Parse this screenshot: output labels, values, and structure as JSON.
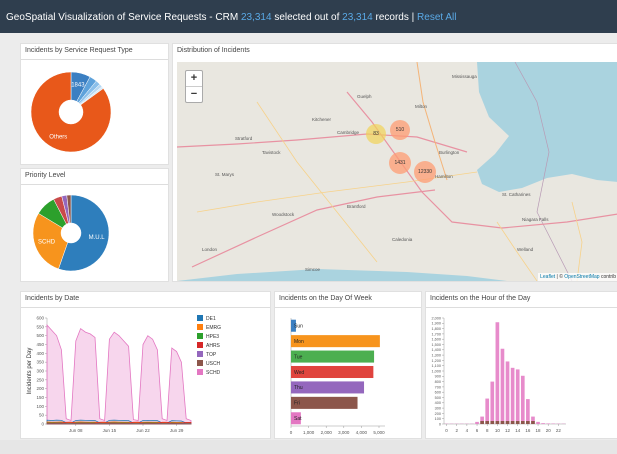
{
  "header": {
    "title": "GeoSpatial Visualization of Service Requests - CRM",
    "selected_count": "23,314",
    "selected_text": "selected out of",
    "total_count": "23,314",
    "records_text": "records |",
    "reset_label": "Reset All"
  },
  "panels": {
    "type_title": "Incidents by Service Request Type",
    "priority_title": "Priority Level",
    "map_title": "Distribution of Incidents",
    "date_title": "Incidents by Date",
    "week_title": "Incidents on the Day Of Week",
    "hour_title": "Incidents on the Hour of the Day"
  },
  "map": {
    "zoom_in": "+",
    "zoom_out": "−",
    "attribution_leaflet": "Leaflet",
    "attribution_sep": " | © ",
    "attribution_osm": "OpenStreetMap",
    "attribution_tail": " contrib",
    "clusters": [
      "83",
      "510",
      "1431",
      "12330"
    ],
    "labels": [
      "Guelph",
      "Kitchener",
      "Cambridge",
      "Stratford",
      "Tavistock",
      "St. Marys",
      "Brantford",
      "Woodstock",
      "London",
      "Burlington",
      "Hamilton",
      "Mississauga",
      "St. Catharines",
      "Niagara Falls",
      "Welland",
      "Caledonia",
      "Milton",
      "Simcoe"
    ]
  },
  "chart_data": [
    {
      "type": "pie",
      "title": "Incidents by Service Request Type",
      "labels": [
        "1843",
        "",
        "",
        "",
        "",
        "Others"
      ],
      "values": [
        1843,
        700,
        450,
        300,
        200,
        19821
      ],
      "colors": [
        "#3b7fc2",
        "#5ea2db",
        "#8cc0ea",
        "#b7d8f2",
        "#d6e9f8",
        "#e8581a"
      ]
    },
    {
      "type": "pie",
      "title": "Priority Level",
      "labels": [
        "M.U.L",
        "SCHD",
        "",
        "",
        "",
        ""
      ],
      "values": [
        12900,
        6600,
        2050,
        850,
        500,
        414
      ],
      "colors": [
        "#2e7ebc",
        "#f7941d",
        "#2ca02c",
        "#c94a4a",
        "#9467bd",
        "#8c564b"
      ]
    },
    {
      "type": "area",
      "title": "Incidents by Date",
      "ylabel": "Incidents per Day",
      "yticks": [
        "0",
        "50",
        "100",
        "150",
        "200",
        "250",
        "300",
        "350",
        "400",
        "450",
        "500",
        "550",
        "600"
      ],
      "xticks": [
        "Jun 08",
        "Jun 15",
        "Jun 22",
        "Jun 29"
      ],
      "ylim": [
        0,
        600
      ],
      "legend": [
        "DE1",
        "EMRG",
        "HPE3",
        "AHRS",
        "TOP",
        "USCH",
        "SCHD"
      ],
      "legend_colors": [
        "#1f77b4",
        "#ff7f0e",
        "#2ca02c",
        "#d62728",
        "#9467bd",
        "#8c564b",
        "#e377c2"
      ],
      "x_days": [
        0,
        1,
        2,
        3,
        4,
        5,
        6,
        7,
        8,
        9,
        10,
        11,
        12,
        13,
        14,
        15,
        16,
        17,
        18,
        19,
        20,
        21,
        22,
        23,
        24,
        25,
        26,
        27,
        28,
        29,
        30
      ],
      "tick_days": [
        6,
        13,
        20,
        27
      ],
      "series": [
        {
          "name": "SCHD",
          "values": [
            560,
            530,
            500,
            420,
            30,
            20,
            470,
            540,
            520,
            510,
            490,
            30,
            20,
            480,
            520,
            500,
            470,
            440,
            25,
            20,
            450,
            500,
            480,
            420,
            30,
            20,
            430,
            410,
            350,
            30,
            20
          ]
        },
        {
          "name": "DE1",
          "values": [
            22,
            20,
            22,
            21,
            8,
            6,
            20,
            22,
            21,
            20,
            20,
            7,
            6,
            21,
            22,
            21,
            20,
            19,
            6,
            6,
            20,
            21,
            20,
            19,
            6,
            5,
            19,
            18,
            17,
            6,
            5
          ]
        },
        {
          "name": "EMRG",
          "values": [
            12,
            10,
            11,
            12,
            8,
            7,
            11,
            12,
            11,
            10,
            11,
            8,
            7,
            11,
            12,
            11,
            10,
            10,
            7,
            7,
            10,
            11,
            10,
            10,
            7,
            6,
            10,
            9,
            9,
            6,
            6
          ]
        },
        {
          "name": "HPE3",
          "values": [
            8,
            7,
            8,
            8,
            4,
            3,
            7,
            8,
            8,
            7,
            7,
            4,
            3,
            8,
            8,
            7,
            7,
            7,
            3,
            3,
            7,
            8,
            7,
            7,
            3,
            3,
            7,
            6,
            6,
            3,
            3
          ]
        },
        {
          "name": "AHRS",
          "values": [
            6,
            5,
            6,
            6,
            10,
            11,
            5,
            6,
            6,
            5,
            6,
            10,
            11,
            6,
            6,
            5,
            5,
            5,
            10,
            11,
            5,
            6,
            5,
            5,
            10,
            10,
            5,
            5,
            5,
            9,
            9
          ]
        },
        {
          "name": "TOP",
          "values": [
            4,
            4,
            4,
            4,
            2,
            2,
            4,
            4,
            4,
            4,
            4,
            2,
            2,
            4,
            4,
            4,
            4,
            4,
            2,
            2,
            4,
            4,
            4,
            4,
            2,
            2,
            4,
            4,
            4,
            2,
            2
          ]
        },
        {
          "name": "USCH",
          "values": [
            3,
            3,
            3,
            3,
            1,
            1,
            3,
            3,
            3,
            3,
            3,
            1,
            1,
            3,
            3,
            3,
            3,
            3,
            1,
            1,
            3,
            3,
            3,
            3,
            1,
            1,
            3,
            3,
            3,
            1,
            1
          ]
        }
      ]
    },
    {
      "type": "bar",
      "title": "Incidents on the Day Of Week",
      "categories": [
        "Sun",
        "Mon",
        "Tue",
        "Wed",
        "Thu",
        "Fri",
        "Sat"
      ],
      "values": [
        280,
        5050,
        4720,
        4680,
        4150,
        3780,
        560
      ],
      "colors": [
        "#3b7fc2",
        "#f7941d",
        "#4caf50",
        "#e0443e",
        "#9467bd",
        "#8c564b",
        "#e377c2"
      ],
      "xticks": [
        "0",
        "1,000",
        "2,000",
        "3,000",
        "4,000",
        "5,000"
      ],
      "xlim": [
        0,
        5000
      ]
    },
    {
      "type": "bar",
      "title": "Incidents on the Hour of the Day",
      "categories": [
        "0",
        "1",
        "2",
        "3",
        "4",
        "5",
        "6",
        "7",
        "8",
        "9",
        "10",
        "11",
        "12",
        "13",
        "14",
        "15",
        "16",
        "17",
        "18",
        "19",
        "20",
        "21",
        "22",
        "23"
      ],
      "values": [
        5,
        5,
        5,
        5,
        5,
        5,
        40,
        140,
        480,
        800,
        1920,
        1420,
        1180,
        1060,
        1030,
        910,
        470,
        140,
        40,
        15,
        10,
        8,
        6,
        5
      ],
      "xticks": [
        "0",
        "2",
        "4",
        "6",
        "8",
        "10",
        "12",
        "14",
        "16",
        "18",
        "20",
        "22"
      ],
      "yticks": [
        "0",
        "100",
        "200",
        "300",
        "400",
        "500",
        "600",
        "700",
        "800",
        "900",
        "1,000",
        "1,100",
        "1,200",
        "1,300",
        "1,400",
        "1,500",
        "1,600",
        "1,700",
        "1,800",
        "1,900",
        "2,000"
      ],
      "ylim": [
        0,
        2000
      ]
    }
  ]
}
